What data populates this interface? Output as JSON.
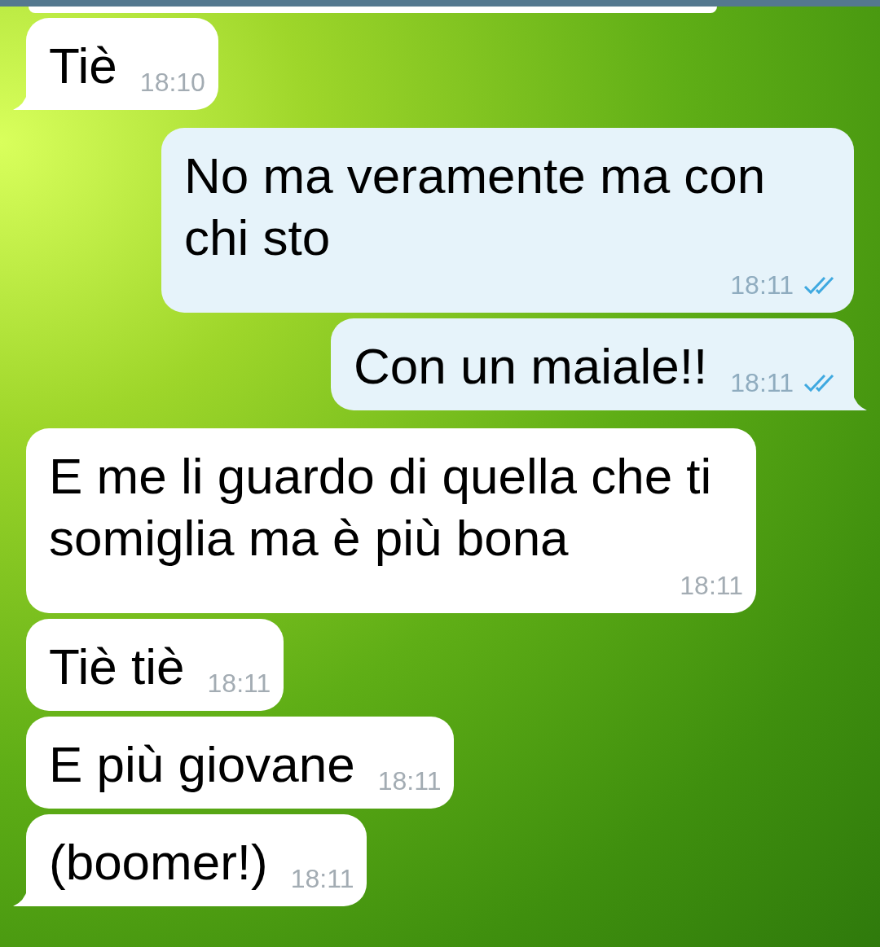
{
  "messages": [
    {
      "kind": "in",
      "text": "Tiè",
      "time": "18:10",
      "tail": true
    },
    {
      "kind": "out",
      "text": "No ma veramente ma con chi sto",
      "time": "18:11",
      "read": true,
      "tail": false
    },
    {
      "kind": "out",
      "text": "Con un maiale!!",
      "time": "18:11",
      "read": true,
      "tail": true
    },
    {
      "kind": "in",
      "text": "E me li guardo di quella che ti somiglia ma è più bona",
      "time": "18:11",
      "tail": false
    },
    {
      "kind": "in",
      "text": "Tiè tiè",
      "time": "18:11",
      "tail": false
    },
    {
      "kind": "in",
      "text": "E più giovane",
      "time": "18:11",
      "tail": false
    },
    {
      "kind": "in",
      "text": "(boomer!)",
      "time": "18:11",
      "tail": true
    }
  ]
}
